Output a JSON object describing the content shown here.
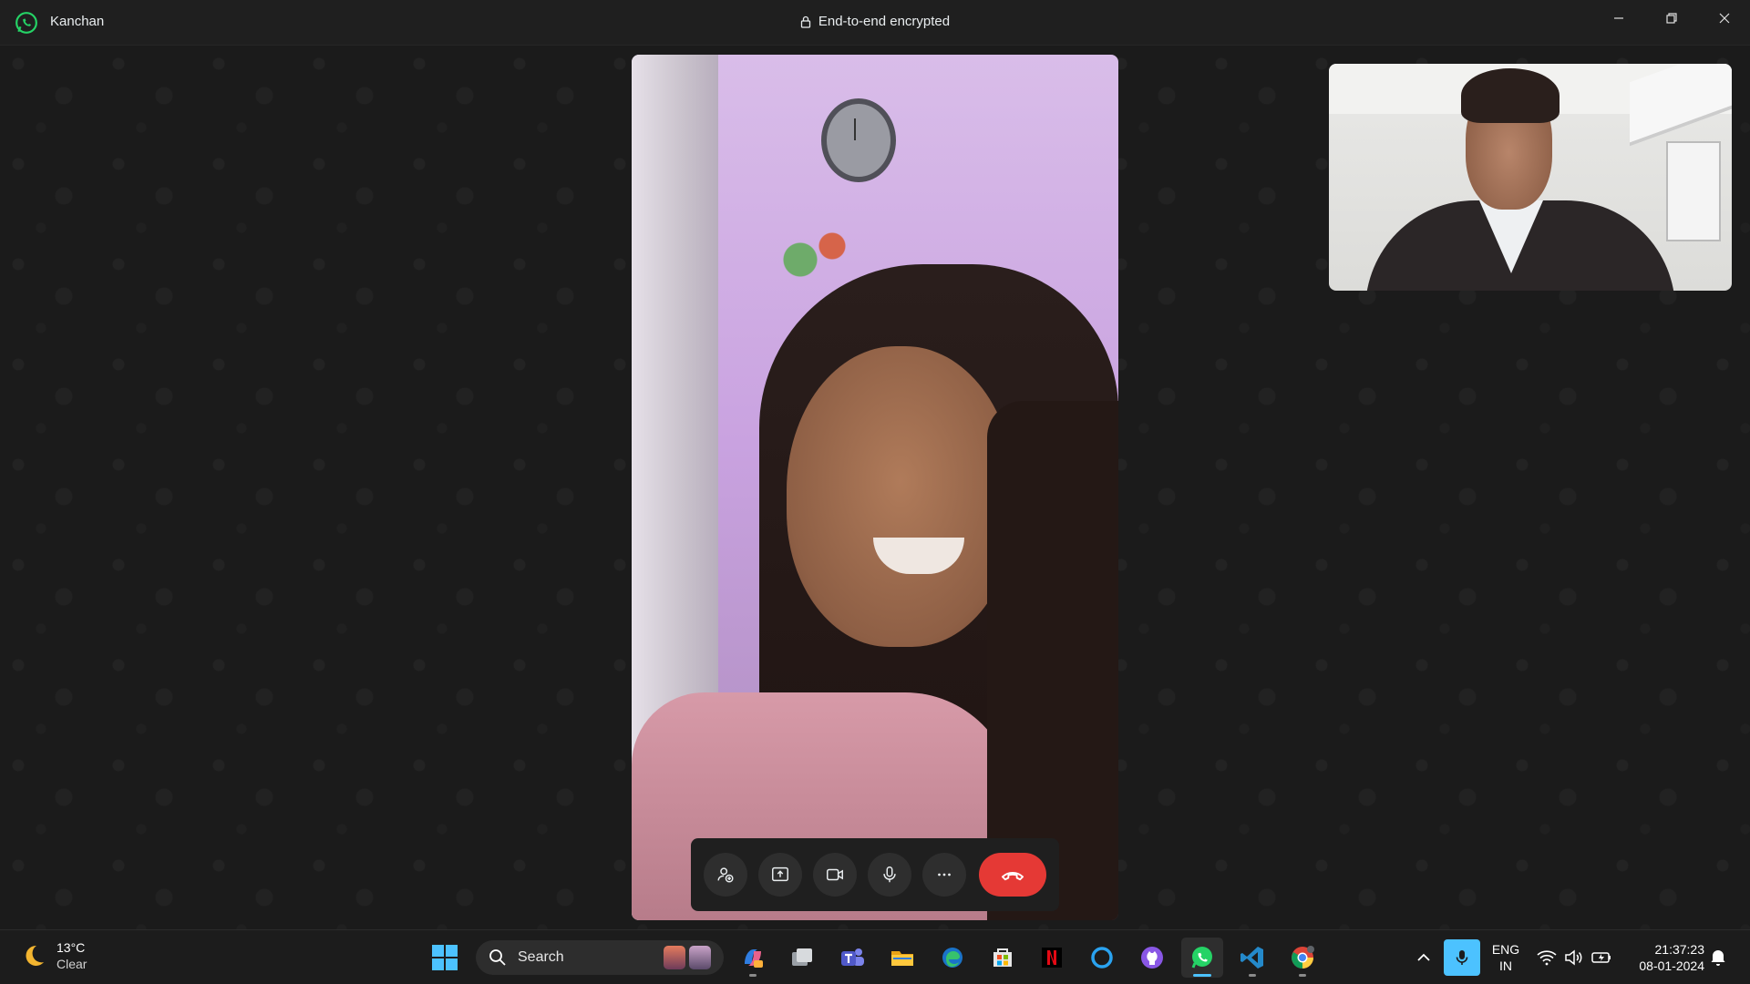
{
  "titlebar": {
    "contact_name": "Kanchan",
    "encryption_label": "End-to-end encrypted",
    "icons": [
      "whatsapp-icon",
      "lock-icon",
      "minimize-icon",
      "restore-icon",
      "close-icon"
    ]
  },
  "call": {
    "controls": [
      "add-participant",
      "share-screen",
      "camera",
      "microphone",
      "more",
      "end-call"
    ],
    "end_call_color": "#e53935"
  },
  "taskbar": {
    "weather": {
      "temperature": "13°C",
      "condition": "Clear",
      "icon": "moon-icon"
    },
    "search_placeholder": "Search",
    "apps": [
      "copilot",
      "task-view",
      "teams",
      "file-explorer",
      "edge",
      "microsoft-store",
      "netflix",
      "cortana",
      "github-desktop",
      "whatsapp",
      "vscode",
      "chrome"
    ],
    "active_app": "whatsapp",
    "language": {
      "line1": "ENG",
      "line2": "IN"
    },
    "time": "21:37:23",
    "date": "08-01-2024",
    "accent_color": "#4cc2ff"
  }
}
